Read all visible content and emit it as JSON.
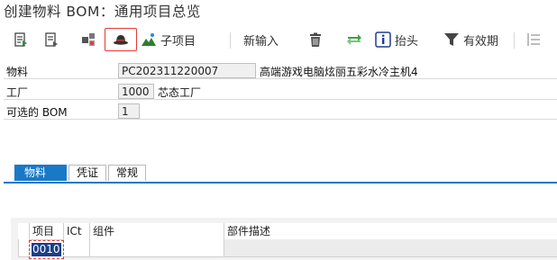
{
  "window": {
    "title": "创建物料 BOM：通用项目总览"
  },
  "toolbar": {
    "buttons": [
      {
        "icon": "document-list-icon",
        "label": ""
      },
      {
        "icon": "document-icon",
        "label": ""
      },
      {
        "icon": "components-icon",
        "label": ""
      },
      {
        "icon": "hat-icon",
        "label": "",
        "selected": true
      },
      {
        "icon": "sub-item-icon",
        "label": "子项目"
      },
      {
        "icon": "",
        "label": "新输入"
      },
      {
        "icon": "trash-icon",
        "label": ""
      },
      {
        "icon": "refresh-arrows-icon",
        "label": ""
      },
      {
        "icon": "info-icon",
        "label": "抬头"
      },
      {
        "icon": "filter-icon",
        "label": "有效期"
      },
      {
        "icon": "list-icon",
        "label": ""
      }
    ]
  },
  "header": {
    "material": {
      "label": "物料",
      "value": "PC202311220007",
      "description": "高端游戏电脑炫丽五彩水冷主机4"
    },
    "plant": {
      "label": "工厂",
      "value": "1000",
      "description": "芯态工厂"
    },
    "alt_bom": {
      "label": "可选的 BOM",
      "value": "1"
    }
  },
  "tabs": [
    {
      "label": "物料",
      "active": true
    },
    {
      "label": "凭证",
      "active": false
    },
    {
      "label": "常规",
      "active": false
    }
  ],
  "table": {
    "columns": [
      "项目",
      "ICt",
      "组件",
      "部件描述"
    ],
    "rows": [
      {
        "item": "0010",
        "ict": "",
        "component": "",
        "description": ""
      }
    ]
  },
  "colors": {
    "accent": "#1979c7",
    "selection": "#e53935",
    "cell_selected": "#1a3f8a"
  }
}
